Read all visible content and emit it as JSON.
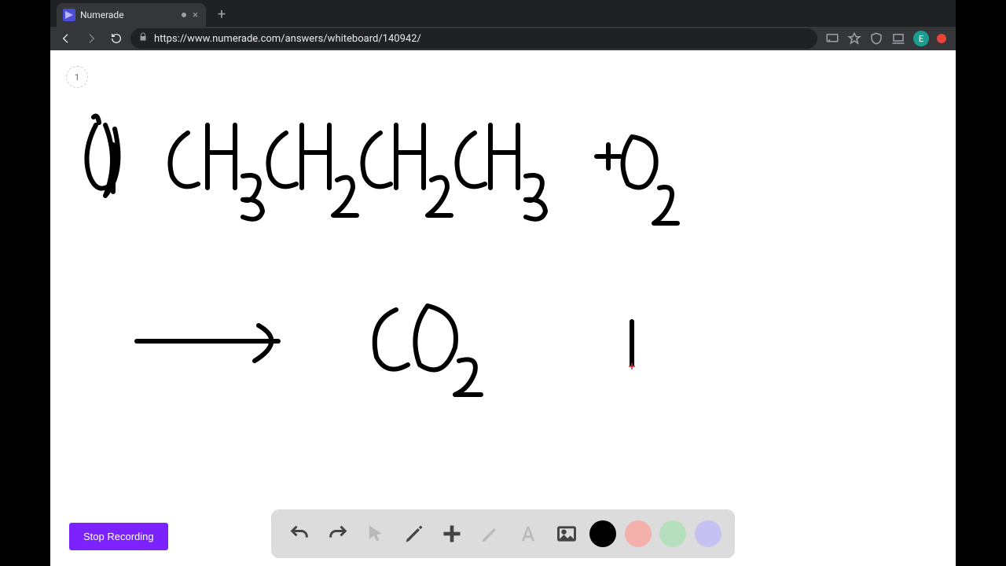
{
  "browser": {
    "tab_title": "Numerade",
    "url": "https://www.numerade.com/answers/whiteboard/140942/",
    "avatar_letter": "E"
  },
  "whiteboard": {
    "page_number": "1",
    "stop_button_label": "Stop Recording",
    "strokes_description": "Handwritten: a) CH3CH2CH2CH3  + O2   →   CO2   (plus partial vertical stroke)"
  },
  "toolbar": {
    "tools": {
      "undo": "undo",
      "redo": "redo",
      "pointer": "pointer",
      "pen": "pen",
      "add": "add",
      "eraser": "eraser",
      "text": "text",
      "image": "image"
    },
    "colors": {
      "black": "#000000",
      "red": "#f4b0aa",
      "green": "#b6e0bd",
      "purple": "#c5c1f2"
    }
  }
}
